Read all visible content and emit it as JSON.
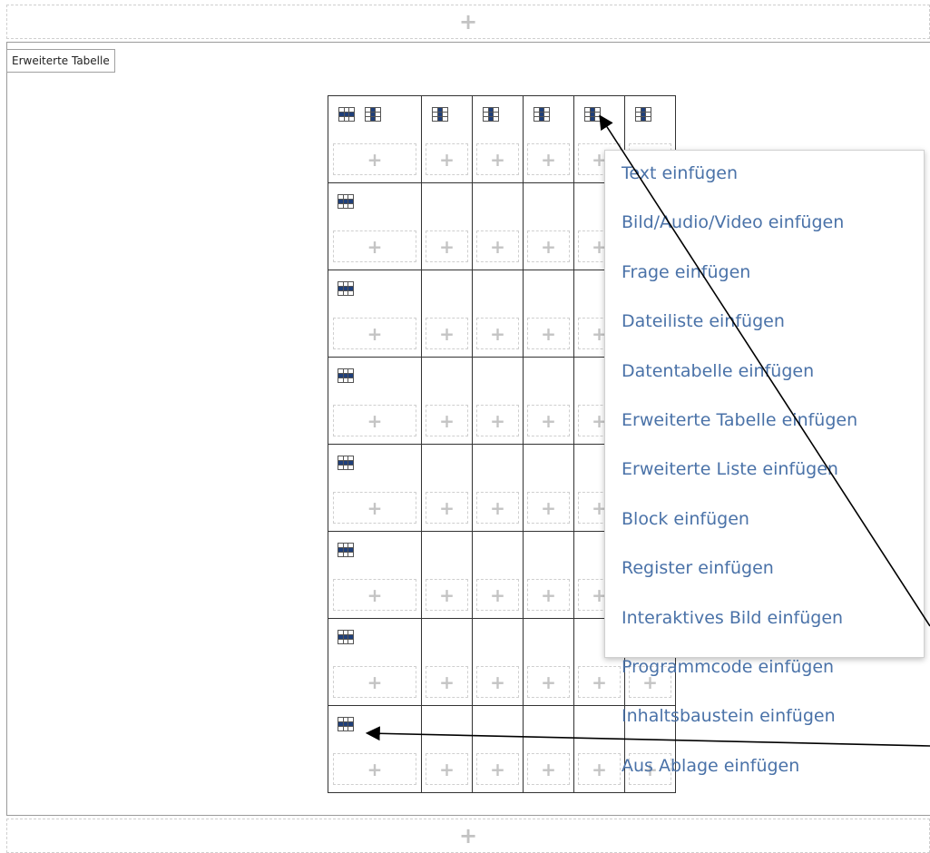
{
  "add_symbol": "+",
  "table_label": "Erweiterte Tabelle",
  "rows": 8,
  "columns": 6,
  "context_menu": {
    "items": [
      "Text einfügen",
      "Bild/Audio/Video einfügen",
      "Frage einfügen",
      "Dateiliste einfügen",
      "Datentabelle einfügen",
      "Erweiterte Tabelle einfügen",
      "Erweiterte Liste einfügen",
      "Block einfügen",
      "Register einfügen",
      "Interaktives Bild einfügen",
      "Programmcode einfügen",
      "Inhaltsbaustein einfügen",
      "Aus Ablage einfügen"
    ]
  },
  "icons": {
    "row_handle": "table-row-icon",
    "column_handle": "table-column-icon",
    "accent": "#1f3f7a"
  }
}
